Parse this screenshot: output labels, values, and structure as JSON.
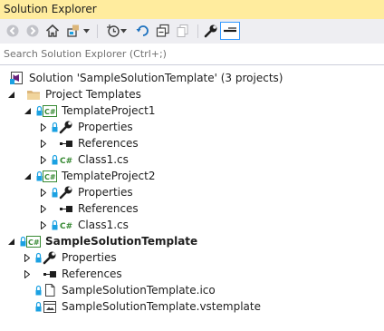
{
  "window": {
    "title": "Solution Explorer"
  },
  "toolbar": {
    "buttons": [
      {
        "name": "back-button",
        "icon": "back-arrow-icon"
      },
      {
        "name": "forward-button",
        "icon": "forward-arrow-icon"
      },
      {
        "name": "home-button",
        "icon": "home-icon"
      },
      {
        "name": "switch-views-button",
        "icon": "switch-views-icon"
      },
      {
        "name": "pending-changes-filter-button",
        "icon": "history-clock-icon"
      },
      {
        "name": "sync-with-active-document-button",
        "icon": "sync-icon"
      },
      {
        "name": "collapse-all-button",
        "icon": "collapse-all-icon"
      },
      {
        "name": "show-all-files-button",
        "icon": "show-all-files-icon"
      },
      {
        "name": "properties-button",
        "icon": "wrench-icon"
      },
      {
        "name": "preview-selected-items-button",
        "icon": "preview-icon"
      }
    ]
  },
  "search": {
    "placeholder": "Search Solution Explorer (Ctrl+;)"
  },
  "tree": {
    "solution": "Solution 'SampleSolutionTemplate' (3 projects)",
    "project_templates_folder": "Project Templates",
    "template_project_1": {
      "name": "TemplateProject1",
      "properties": "Properties",
      "references": "References",
      "class_file": "Class1.cs"
    },
    "template_project_2": {
      "name": "TemplateProject2",
      "properties": "Properties",
      "references": "References",
      "class_file": "Class1.cs"
    },
    "sample_project": {
      "name": "SampleSolutionTemplate",
      "properties": "Properties",
      "references": "References",
      "ico_file": "SampleSolutionTemplate.ico",
      "vstemplate_file": "SampleSolutionTemplate.vstemplate"
    }
  },
  "colors": {
    "title_bar": "#ffec9e",
    "toolbar_bg": "#eeeef2",
    "csharp_green": "#388a34",
    "folder_tan": "#dcb67a",
    "lock_blue": "#1ba1e2",
    "vs_purple": "#68217a"
  }
}
